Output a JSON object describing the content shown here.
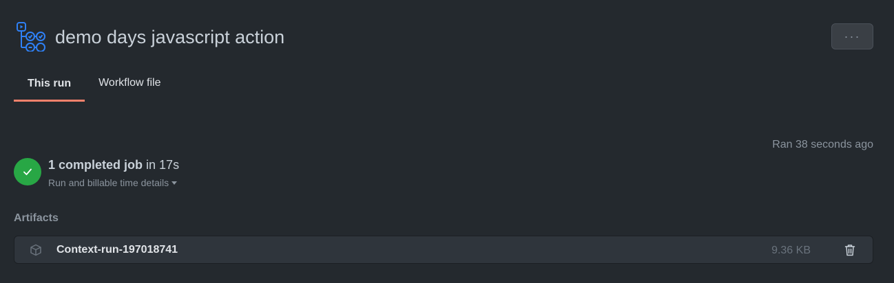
{
  "header": {
    "title": "demo days javascript action",
    "more_label": "···",
    "icon": "workflow-icon"
  },
  "tabs": [
    {
      "label": "This run",
      "active": true
    },
    {
      "label": "Workflow file",
      "active": false
    }
  ],
  "run": {
    "ran_ago": "Ran 38 seconds ago",
    "status_icon": "check-icon",
    "status_color": "#28a745",
    "jobs_text": "1 completed job",
    "duration_text": " in 17s",
    "billing_link": "Run and billable time details"
  },
  "artifacts": {
    "heading": "Artifacts",
    "items": [
      {
        "name": "Context-run-197018741",
        "size": "9.36 KB",
        "icon": "package-icon",
        "action_icon": "trash-icon"
      }
    ]
  },
  "colors": {
    "background": "#24292e",
    "accent_tab": "#f9826c",
    "success": "#28a745",
    "workflow_icon": "#2f81f7"
  }
}
